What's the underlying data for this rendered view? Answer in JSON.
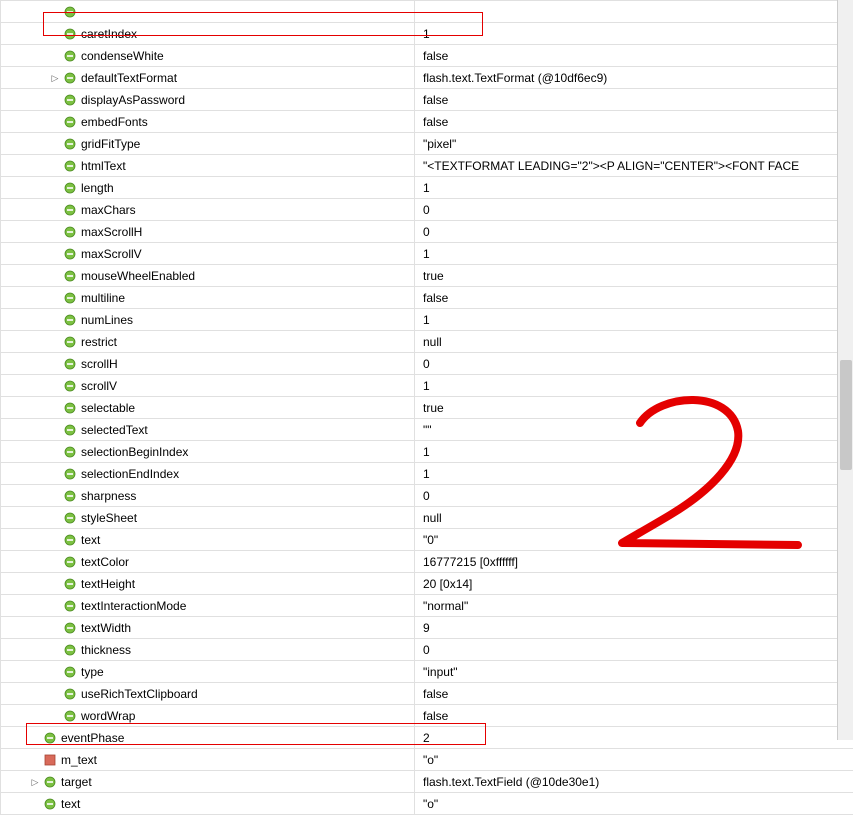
{
  "rows": [
    {
      "indent": 2,
      "expander": "",
      "icon": "circle-prop",
      "name": "",
      "value": ""
    },
    {
      "indent": 2,
      "expander": "",
      "icon": "circle-prop",
      "name": "caretIndex",
      "value": "1"
    },
    {
      "indent": 2,
      "expander": "",
      "icon": "circle-prop",
      "name": "condenseWhite",
      "value": "false"
    },
    {
      "indent": 2,
      "expander": "▷",
      "icon": "circle-prop",
      "name": "defaultTextFormat",
      "value": "flash.text.TextFormat (@10df6ec9)"
    },
    {
      "indent": 2,
      "expander": "",
      "icon": "circle-prop",
      "name": "displayAsPassword",
      "value": "false"
    },
    {
      "indent": 2,
      "expander": "",
      "icon": "circle-prop",
      "name": "embedFonts",
      "value": "false"
    },
    {
      "indent": 2,
      "expander": "",
      "icon": "circle-prop",
      "name": "gridFitType",
      "value": "\"pixel\""
    },
    {
      "indent": 2,
      "expander": "",
      "icon": "circle-prop",
      "name": "htmlText",
      "value": "\"<TEXTFORMAT LEADING=\"2\"><P ALIGN=\"CENTER\"><FONT FACE"
    },
    {
      "indent": 2,
      "expander": "",
      "icon": "circle-prop",
      "name": "length",
      "value": "1"
    },
    {
      "indent": 2,
      "expander": "",
      "icon": "circle-prop",
      "name": "maxChars",
      "value": "0"
    },
    {
      "indent": 2,
      "expander": "",
      "icon": "circle-prop",
      "name": "maxScrollH",
      "value": "0"
    },
    {
      "indent": 2,
      "expander": "",
      "icon": "circle-prop",
      "name": "maxScrollV",
      "value": "1"
    },
    {
      "indent": 2,
      "expander": "",
      "icon": "circle-prop",
      "name": "mouseWheelEnabled",
      "value": "true"
    },
    {
      "indent": 2,
      "expander": "",
      "icon": "circle-prop",
      "name": "multiline",
      "value": "false"
    },
    {
      "indent": 2,
      "expander": "",
      "icon": "circle-prop",
      "name": "numLines",
      "value": "1"
    },
    {
      "indent": 2,
      "expander": "",
      "icon": "circle-prop",
      "name": "restrict",
      "value": "null"
    },
    {
      "indent": 2,
      "expander": "",
      "icon": "circle-prop",
      "name": "scrollH",
      "value": "0"
    },
    {
      "indent": 2,
      "expander": "",
      "icon": "circle-prop",
      "name": "scrollV",
      "value": "1"
    },
    {
      "indent": 2,
      "expander": "",
      "icon": "circle-prop",
      "name": "selectable",
      "value": "true"
    },
    {
      "indent": 2,
      "expander": "",
      "icon": "circle-prop",
      "name": "selectedText",
      "value": "\"\""
    },
    {
      "indent": 2,
      "expander": "",
      "icon": "circle-prop",
      "name": "selectionBeginIndex",
      "value": "1"
    },
    {
      "indent": 2,
      "expander": "",
      "icon": "circle-prop",
      "name": "selectionEndIndex",
      "value": "1"
    },
    {
      "indent": 2,
      "expander": "",
      "icon": "circle-prop",
      "name": "sharpness",
      "value": "0"
    },
    {
      "indent": 2,
      "expander": "",
      "icon": "circle-prop",
      "name": "styleSheet",
      "value": "null"
    },
    {
      "indent": 2,
      "expander": "",
      "icon": "circle-prop",
      "name": "text",
      "value": "\"0\""
    },
    {
      "indent": 2,
      "expander": "",
      "icon": "circle-prop",
      "name": "textColor",
      "value": "16777215 [0xffffff]"
    },
    {
      "indent": 2,
      "expander": "",
      "icon": "circle-prop",
      "name": "textHeight",
      "value": "20 [0x14]"
    },
    {
      "indent": 2,
      "expander": "",
      "icon": "circle-prop",
      "name": "textInteractionMode",
      "value": "\"normal\""
    },
    {
      "indent": 2,
      "expander": "",
      "icon": "circle-prop",
      "name": "textWidth",
      "value": "9"
    },
    {
      "indent": 2,
      "expander": "",
      "icon": "circle-prop",
      "name": "thickness",
      "value": "0"
    },
    {
      "indent": 2,
      "expander": "",
      "icon": "circle-prop",
      "name": "type",
      "value": "\"input\""
    },
    {
      "indent": 2,
      "expander": "",
      "icon": "circle-prop",
      "name": "useRichTextClipboard",
      "value": "false"
    },
    {
      "indent": 2,
      "expander": "",
      "icon": "circle-prop",
      "name": "wordWrap",
      "value": "false"
    },
    {
      "indent": 1,
      "expander": "",
      "icon": "circle-prop",
      "name": "eventPhase",
      "value": "2"
    },
    {
      "indent": 1,
      "expander": "",
      "icon": "square-var",
      "name": "m_text",
      "value": "\"o\""
    },
    {
      "indent": 1,
      "expander": "▷",
      "icon": "circle-prop",
      "name": "target",
      "value": "flash.text.TextField (@10de30e1)"
    },
    {
      "indent": 1,
      "expander": "",
      "icon": "circle-prop",
      "name": "text",
      "value": "\"o\""
    }
  ]
}
